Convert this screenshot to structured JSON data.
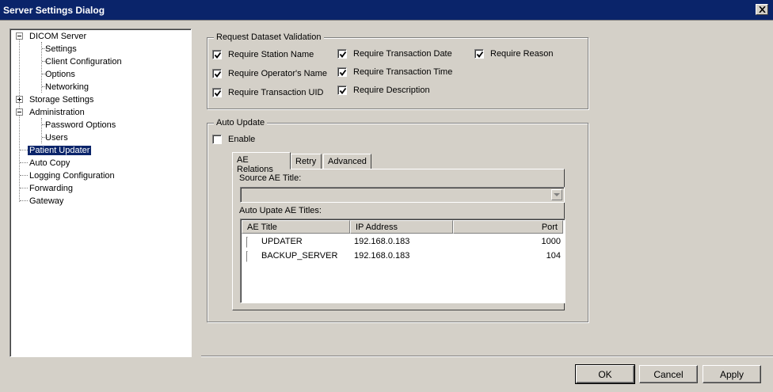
{
  "window": {
    "title": "Server Settings Dialog"
  },
  "tree": {
    "dicom_server": "DICOM Server",
    "settings": "Settings",
    "client_configuration": "Client Configuration",
    "options": "Options",
    "networking": "Networking",
    "storage_settings": "Storage Settings",
    "administration": "Administration",
    "password_options": "Password Options",
    "users": "Users",
    "patient_updater": "Patient Updater",
    "auto_copy": "Auto Copy",
    "logging_configuration": "Logging Configuration",
    "forwarding": "Forwarding",
    "gateway": "Gateway"
  },
  "validation": {
    "legend": "Request Dataset Validation",
    "require_station_name": {
      "label": "Require Station Name",
      "checked": true
    },
    "require_operator_name": {
      "label": "Require Operator's Name",
      "checked": true
    },
    "require_transaction_uid": {
      "label": "Require Transaction UID",
      "checked": true
    },
    "require_transaction_date": {
      "label": "Require Transaction Date",
      "checked": true
    },
    "require_transaction_time": {
      "label": "Require Transaction Time",
      "checked": true
    },
    "require_description": {
      "label": "Require Description",
      "checked": true
    },
    "require_reason": {
      "label": "Require Reason",
      "checked": true
    }
  },
  "auto_update": {
    "legend": "Auto Update",
    "enable": {
      "label": "Enable",
      "checked": false
    },
    "tabs": [
      "AE Relations",
      "Retry",
      "Advanced"
    ],
    "source_ae_label": "Source AE Title:",
    "source_ae_value": "",
    "titles_label": "Auto Upate AE Titles:",
    "columns": [
      "AE Title",
      "IP Address",
      "Port"
    ],
    "rows": [
      {
        "checked": false,
        "ae_title": "UPDATER",
        "ip": "192.168.0.183",
        "port": "1000"
      },
      {
        "checked": false,
        "ae_title": "BACKUP_SERVER",
        "ip": "192.168.0.183",
        "port": "104"
      }
    ]
  },
  "buttons": {
    "ok": "OK",
    "cancel": "Cancel",
    "apply": "Apply"
  },
  "icons": [
    "close-icon",
    "checkmark-icon",
    "dropdown-arrow-icon",
    "tree-expand-icon",
    "tree-collapse-icon"
  ]
}
